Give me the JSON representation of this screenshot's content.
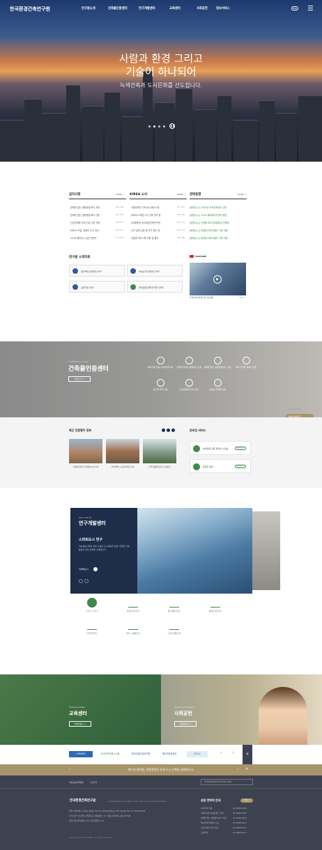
{
  "header": {
    "logo": "한국환경건축연구원",
    "nav": [
      "연구원소개",
      "건축물인증센터",
      "연구개발센터",
      "교육센터",
      "사회공헌",
      "정보서비스"
    ],
    "lang": "ENG"
  },
  "hero": {
    "line1": "사람과 환경 그리고",
    "line2": "기술이 하나되어",
    "sub": "녹색건축과 도시문화를 선도합니다."
  },
  "news": {
    "col1": {
      "title": "공지사항",
      "more": "MORE +",
      "items": [
        {
          "t": "· 장애를 없는 생활환경(BF) 개정 ·",
          "d": "[04-18]"
        },
        {
          "t": "· 장애를 없는 생활환경(BF) 인증 ·",
          "d": "[03-30]"
        },
        {
          "t": "· 건강친화형 주택 건설 기준 개정 ·",
          "d": "[03-07]"
        },
        {
          "t": "· KIREA 모집, 장애인 인식 개선 ·",
          "d": "[01-21]"
        },
        {
          "t": "· 2019 웰비우니 실천 전문가 ·",
          "d": "[11-08]"
        }
      ]
    },
    "col2": {
      "title": "KIREA 소식",
      "more": "MORE +",
      "items": [
        {
          "t": "· 서울대학교 지속가능 플러스캠 ·",
          "d": "[07-01]"
        },
        {
          "t": "· [KIREA 포럼] 1차 건축 관리 등 ·",
          "d": "[03-28]"
        },
        {
          "t": "· [국제협력] 한국환경건축연구원 ·",
          "d": "[03-11]"
        },
        {
          "t": "· 주관 공제 입문 및 전기 제도 등 ·",
          "d": "[02-11]"
        },
        {
          "t": "· 친환경 학교시책 지원 및 협약 ·",
          "d": "[01-29]"
        }
      ]
    },
    "col3": {
      "title": "관련동향",
      "more": "MORE +",
      "items": [
        {
          "t": "[동향/뉴스] 2020년 녹색건축센터 선정 ·",
          "d": ""
        },
        {
          "t": "[동향/뉴스] 2020 제로에너지건축 동향 ·",
          "d": ""
        },
        {
          "t": "[동향/뉴스] 건축물 에너지효율등급 인증제 ·",
          "d": ""
        },
        {
          "t": "[동향/뉴스] 환경부/국토교통부 기준 개정 ·",
          "d": ""
        },
        {
          "t": "[동향/뉴스] 환경부/국토교통부 기준 개정 ·",
          "d": ""
        }
      ]
    }
  },
  "intro": {
    "title": "연구원 소개자료",
    "cards": [
      "홍보책자(국문판) PDF",
      "브로슈어(국문판) PDF",
      "실적자료 PDF",
      "한국환경건축연구원 리포트"
    ],
    "youtube": "YOUTUBE",
    "video_caption": "한국환경건축연구원 홍보영상",
    "video_date": "04-12"
  },
  "cert": {
    "sub": "Certification Center",
    "title": "건축물인증센터",
    "btn": "바로가기 >",
    "items": [
      "녹색건축 인증 (주택/업무 등)",
      "건축물 에너지 효율등급 인증",
      "장애물 없는 생활환경(BF) 인증",
      "에너지 절약 계획서 검토",
      "장수명 주택 인증",
      "건강친화형 주택 인증",
      "지능형 건축물 인증"
    ],
    "quick": [
      "인증 주요 업무",
      "에너지효율등급",
      "건강친화형주택",
      "BF 인증",
      "Contact Us"
    ]
  },
  "latest": {
    "title": "최근 인증평가 정보",
    "items": [
      "대치동 임대 근린생활시설 신축",
      "서울특별시 공공건축물 신축",
      "한국전통문화전당 신축공사"
    ],
    "svc_title": "온라인 서비스",
    "svc": [
      {
        "t": "녹색건축 인증 온라인 시스템",
        "b": "바로가기 >"
      },
      {
        "t": "온라인 문의",
        "b": "바로가기 >"
      }
    ]
  },
  "research": {
    "sub": "R&D CENTER",
    "title": "연구개발센터",
    "h": "스마트도시 연구",
    "desc": "지능정보사회의 지속 가능한 도시계획과 설계, 친환경 기술 중심의 혁신 전략을 수립합니다.",
    "more": "자세히보기",
    "fields": [
      "스마트도시 연구",
      "친환경 건축 연구",
      "제로 에너지 연구",
      "에너지 효율 연구",
      "건강주택 연구",
      "지역 도시재생 연구",
      "그린리모델링 연구"
    ]
  },
  "edu": {
    "sub": "Training Center",
    "title": "교육센터",
    "btn": "자세히보기 >"
  },
  "social": {
    "sub": "Social Contribution",
    "title": "사회공헌",
    "btn": "자세히보기 >"
  },
  "partners": [
    "LHRRMS",
    "녹색건축인증시스템",
    "한국건설기술연구원",
    "에너지관리공단",
    "KIREA"
  ],
  "banner": {
    "text": "에너지 절약형, 친환경적인 녹색 도시·건축을 실현합니다.",
    "close": "✕"
  },
  "footer": {
    "links": [
      "개인정보처리방침",
      "이용약관"
    ],
    "family": "한국환경건축연구원 바로가기 사이트",
    "logo": "한국환경건축연구원",
    "logo_en": "Korea Research Institute of Eco-Environmental Architecture",
    "addr1": "본원   서울특별시 강서구 양천로 551-24 한화비즈메트로 2차 1003호  TEL. 02-2088-8108",
    "addr2": "부산지원   부산광역시 해운대구 센텀중앙로 97 센텀스카이비즈 A동 2403호",
    "addr3": "광주지원   광주광역시 서구 상무중앙로 110",
    "copy": "Copyright © 2019 KIREA. All rights reserved.",
    "tel_title": "상담 연락처 안내",
    "tel_btn": "전체보기",
    "tels": [
      {
        "n": "녹색건축 인증",
        "v": "02-2088-8108"
      },
      {
        "n": "건축물 에너지효율등급 인증",
        "v": "02-2088-8109"
      },
      {
        "n": "장애물 없는 생활환경(BF) 인증",
        "v": "02-2088-8110"
      },
      {
        "n": "에너지절약계획서 검토",
        "v": "02-2088-8111"
      },
      {
        "n": "건강친화형 주택 인증",
        "v": "02-2088-8112"
      },
      {
        "n": "교육센터",
        "v": "02-2088-8113"
      }
    ]
  }
}
